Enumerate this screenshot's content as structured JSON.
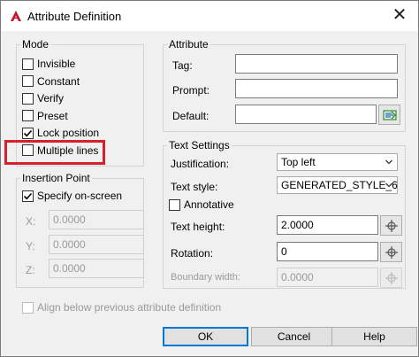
{
  "window": {
    "title": "Attribute Definition",
    "close_glyph": "✕",
    "app_icon": "autocad-a-icon"
  },
  "mode": {
    "label": "Mode",
    "items": [
      {
        "label": "Invisible",
        "checked": false
      },
      {
        "label": "Constant",
        "checked": false
      },
      {
        "label": "Verify",
        "checked": false
      },
      {
        "label": "Preset",
        "checked": false
      },
      {
        "label": "Lock position",
        "checked": true
      },
      {
        "label": "Multiple lines",
        "checked": false
      }
    ]
  },
  "insertion": {
    "label": "Insertion Point",
    "specify_label": "Specify on-screen",
    "specify_checked": true,
    "x_label": "X:",
    "x_value": "0.0000",
    "y_label": "Y:",
    "y_value": "0.0000",
    "z_label": "Z:",
    "z_value": "0.0000"
  },
  "attribute": {
    "label": "Attribute",
    "tag_label": "Tag:",
    "tag_value": "",
    "prompt_label": "Prompt:",
    "prompt_value": "",
    "default_label": "Default:",
    "default_value": ""
  },
  "text_settings": {
    "label": "Text Settings",
    "justification_label": "Justification:",
    "justification_value": "Top left",
    "text_style_label": "Text style:",
    "text_style_value": "GENERATED_STYLE_6",
    "annotative_label": "Annotative",
    "annotative_checked": false,
    "text_height_label": "Text height:",
    "text_height_value": "2.0000",
    "rotation_label": "Rotation:",
    "rotation_value": "0",
    "boundary_label": "Boundary width:",
    "boundary_value": "0.0000"
  },
  "align_label": "Align below previous attribute definition",
  "buttons": {
    "ok": "OK",
    "cancel": "Cancel",
    "help": "Help"
  },
  "colors": {
    "highlight": "#d8202a",
    "app_icon": "#c8102e",
    "default_button_border": "#0078d7"
  }
}
